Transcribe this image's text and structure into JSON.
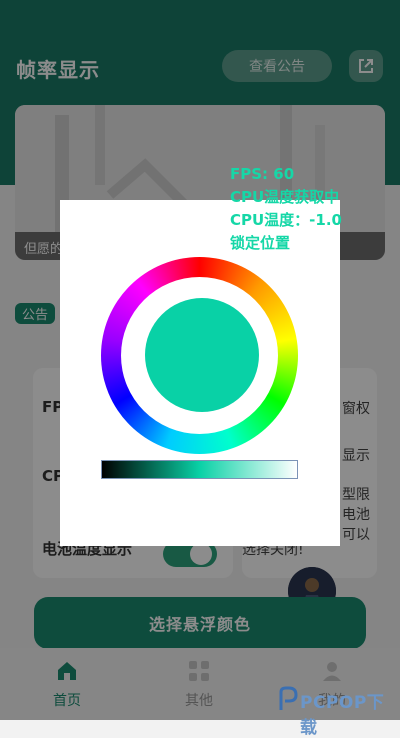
{
  "header": {
    "title": "帧率显示",
    "notice_button": "查看公告",
    "share_icon": "share-icon"
  },
  "banner": {
    "caption": "但愿的"
  },
  "notice_tag": "公告",
  "cards": {
    "left_rows": [
      "FP",
      "CP",
      "电池温度显示"
    ],
    "right_lines": [
      "窗权",
      "显示",
      "型限",
      "电池",
      "可以",
      "选择关闭!"
    ]
  },
  "main_button": "选择悬浮颜色",
  "nav": {
    "items": [
      {
        "label": "首页",
        "icon": "home-icon",
        "active": true
      },
      {
        "label": "其他",
        "icon": "grid-icon",
        "active": false
      },
      {
        "label": "我的",
        "icon": "user-icon",
        "active": false
      }
    ]
  },
  "overlay": {
    "fps": "FPS: 60",
    "cpu_status": "CPU温度获取中",
    "cpu_temp": "CPU温度：-1.0",
    "lock": "锁定位置"
  },
  "color_picker": {
    "selected_color": "#09d1a6",
    "wheel_icon": "color-wheel",
    "bar_icon": "brightness-bar"
  },
  "colors": {
    "primary": "#1a7a66",
    "accent": "#1a8a70",
    "overlay_text": "#15d7a7"
  },
  "watermark": "PCPOP下载"
}
